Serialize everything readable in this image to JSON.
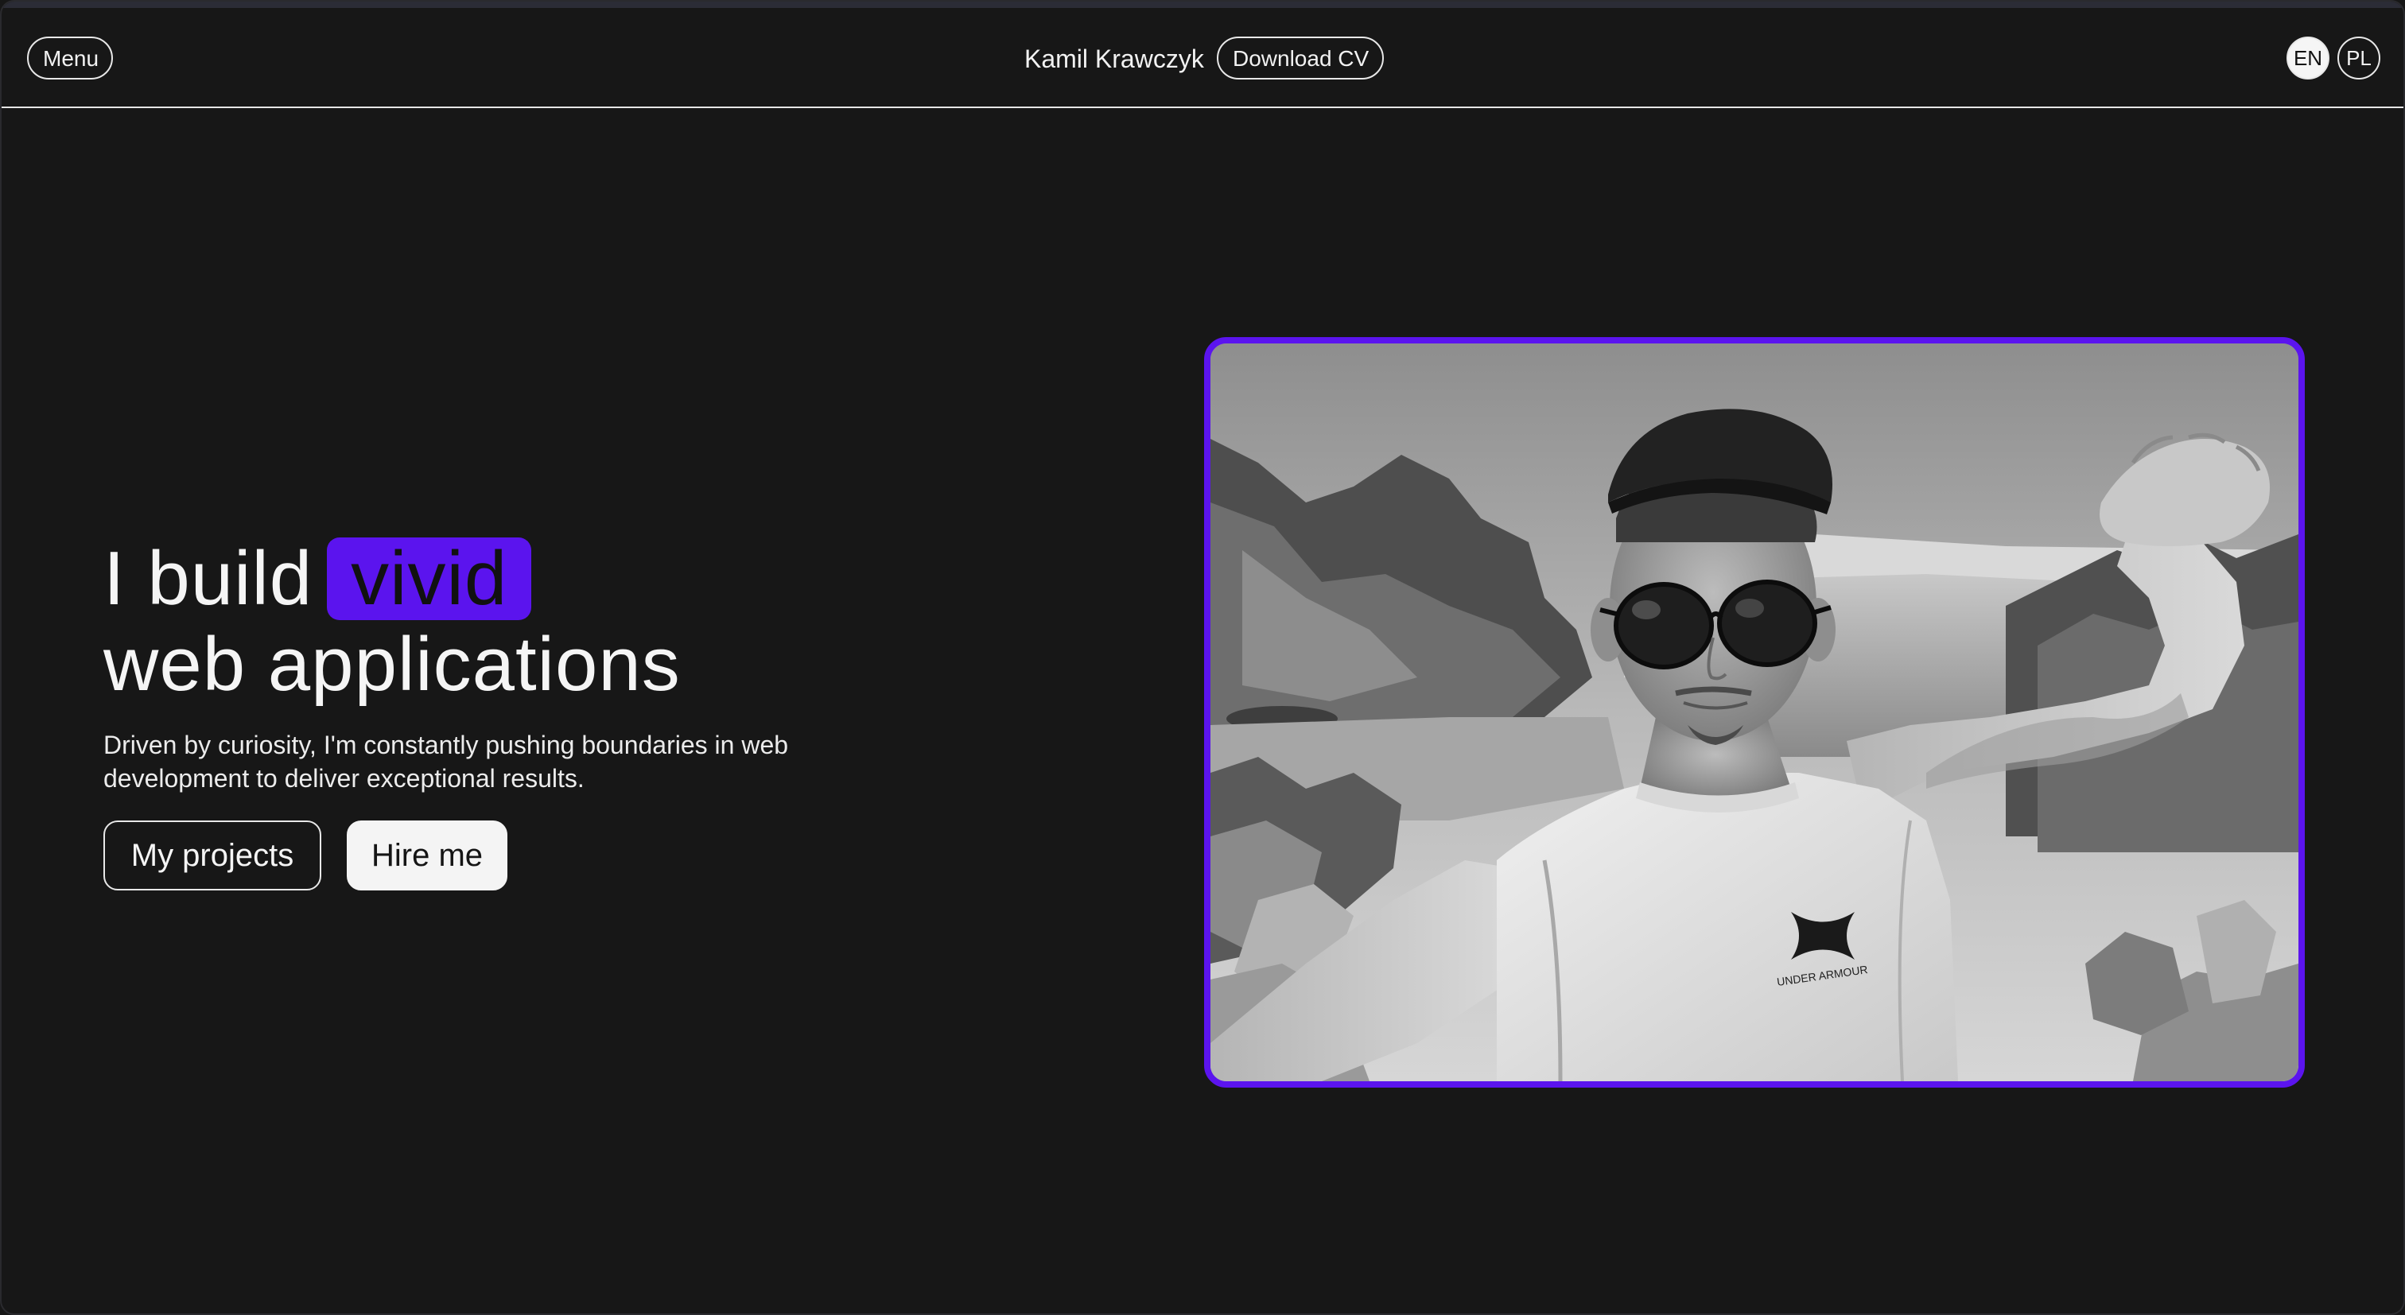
{
  "navbar": {
    "menu_label": "Menu",
    "brand_name": "Kamil Krawczyk",
    "download_cv_label": "Download CV",
    "languages": [
      {
        "code": "EN",
        "active": true
      },
      {
        "code": "PL",
        "active": false
      }
    ]
  },
  "hero": {
    "title_prefix": "I build",
    "title_highlight": "vivid",
    "title_line2": "web applications",
    "subtitle": "Driven by curiosity, I'm constantly pushing boundaries in web development to deliver exceptional results.",
    "primary_button": "My projects",
    "secondary_button": "Hire me",
    "photo": {
      "style": "grayscale",
      "shirt_logo_text": "UNDER ARMOUR"
    }
  },
  "colors": {
    "background": "#171717",
    "accent": "#5b14ee",
    "text": "#f5f5f5"
  }
}
